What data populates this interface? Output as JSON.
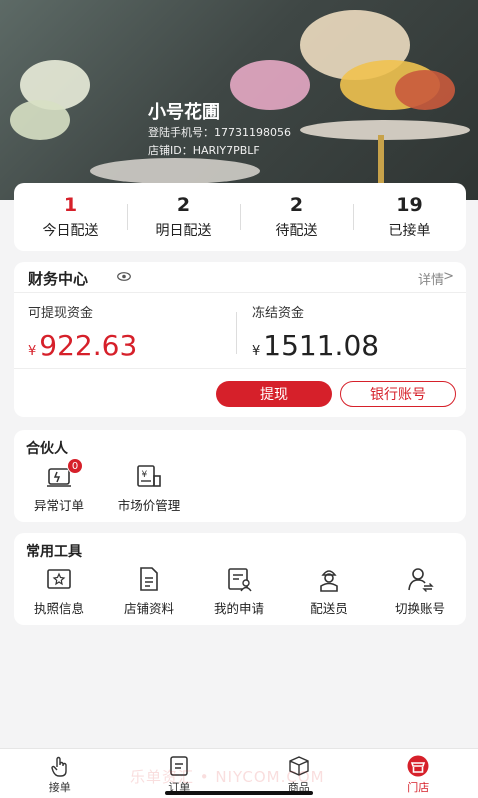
{
  "shop": {
    "name": "小号花圃",
    "phone_line": "登陆手机号：17731198056",
    "id_line": "店铺ID：HARIY7PBLF"
  },
  "stats": [
    {
      "value": "1",
      "label": "今日配送"
    },
    {
      "value": "2",
      "label": "明日配送"
    },
    {
      "value": "2",
      "label": "待配送"
    },
    {
      "value": "19",
      "label": "已接单"
    }
  ],
  "finance": {
    "title": "财务中心",
    "detail_label": "详情",
    "detail_arrow": ">",
    "withdrawable_label": "可提现资金",
    "withdrawable_currency": "¥",
    "withdrawable_amount": "922.63",
    "frozen_label": "冻结资金",
    "frozen_currency": "¥",
    "frozen_amount": "1511.08",
    "withdraw_button": "提现",
    "bank_button": "银行账号"
  },
  "partner": {
    "title": "合伙人",
    "items": [
      {
        "label": "异常订单",
        "icon": "abnormal-order-icon",
        "badge": "0"
      },
      {
        "label": "市场价管理",
        "icon": "market-price-icon"
      }
    ]
  },
  "tools": {
    "title": "常用工具",
    "items": [
      {
        "label": "执照信息",
        "icon": "license-icon"
      },
      {
        "label": "店铺资料",
        "icon": "document-icon"
      },
      {
        "label": "我的申请",
        "icon": "application-icon"
      },
      {
        "label": "配送员",
        "icon": "courier-icon"
      },
      {
        "label": "切换账号",
        "icon": "switch-account-icon"
      }
    ]
  },
  "tabbar": [
    {
      "label": "接单",
      "icon": "hand-pointer-icon",
      "active": false
    },
    {
      "label": "订单",
      "icon": "order-list-icon",
      "active": false
    },
    {
      "label": "商品",
      "icon": "box-icon",
      "active": false
    },
    {
      "label": "门店",
      "icon": "store-icon",
      "active": true
    }
  ],
  "watermark": "乐单资汇 • NIYCOM.COM",
  "colors": {
    "accent": "#d6202a",
    "background": "#f4f4f5"
  }
}
